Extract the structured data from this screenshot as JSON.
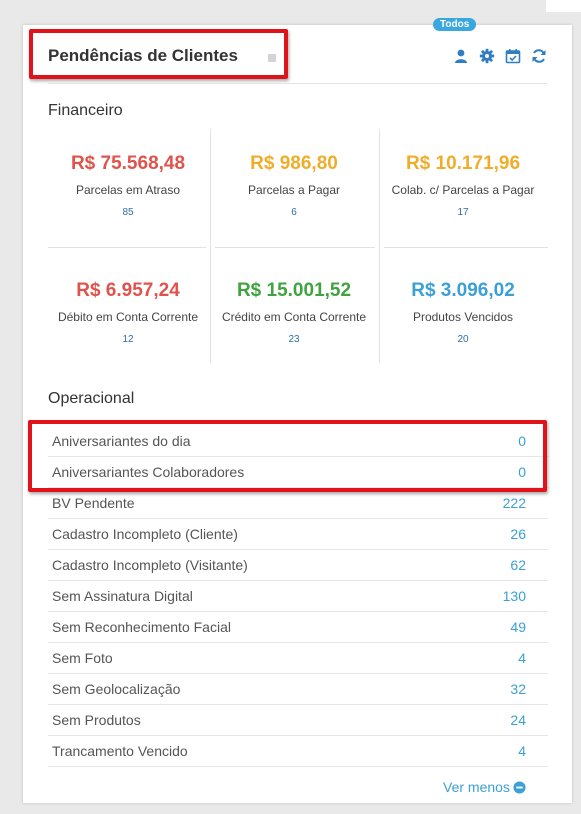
{
  "header": {
    "badge": "Todos",
    "title": "Pendências de Clientes",
    "icons": [
      "user-icon",
      "gear-icon",
      "calendar-check-icon",
      "refresh-icon"
    ]
  },
  "financeiro": {
    "title": "Financeiro",
    "items": [
      {
        "value": "R$ 75.568,48",
        "label": "Parcelas em Atraso",
        "count": "85",
        "color": "#e0534c"
      },
      {
        "value": "R$ 986,80",
        "label": "Parcelas a Pagar",
        "count": "6",
        "color": "#f0ad2a"
      },
      {
        "value": "R$ 10.171,96",
        "label": "Colab. c/ Parcelas a Pagar",
        "count": "17",
        "color": "#f0ad2a"
      },
      {
        "value": "R$ 6.957,24",
        "label": "Débito em Conta Corrente",
        "count": "12",
        "color": "#e0534c"
      },
      {
        "value": "R$ 15.001,52",
        "label": "Crédito em Conta Corrente",
        "count": "23",
        "color": "#3fa33f"
      },
      {
        "value": "R$ 3.096,02",
        "label": "Produtos Vencidos",
        "count": "20",
        "color": "#3aa0d6"
      }
    ]
  },
  "operacional": {
    "title": "Operacional",
    "rows": [
      {
        "label": "Aniversariantes do dia",
        "value": "0"
      },
      {
        "label": "Aniversariantes Colaboradores",
        "value": "0"
      },
      {
        "label": "BV Pendente",
        "value": "222"
      },
      {
        "label": "Cadastro Incompleto (Cliente)",
        "value": "26"
      },
      {
        "label": "Cadastro Incompleto (Visitante)",
        "value": "62"
      },
      {
        "label": "Sem Assinatura Digital",
        "value": "130"
      },
      {
        "label": "Sem Reconhecimento Facial",
        "value": "49"
      },
      {
        "label": "Sem Foto",
        "value": "4"
      },
      {
        "label": "Sem Geolocalização",
        "value": "32"
      },
      {
        "label": "Sem Produtos",
        "value": "24"
      },
      {
        "label": "Trancamento Vencido",
        "value": "4"
      }
    ]
  },
  "footer": {
    "ver_menos": "Ver menos"
  },
  "colors": {
    "accent": "#3aa0d6",
    "highlight": "#e0121a"
  }
}
